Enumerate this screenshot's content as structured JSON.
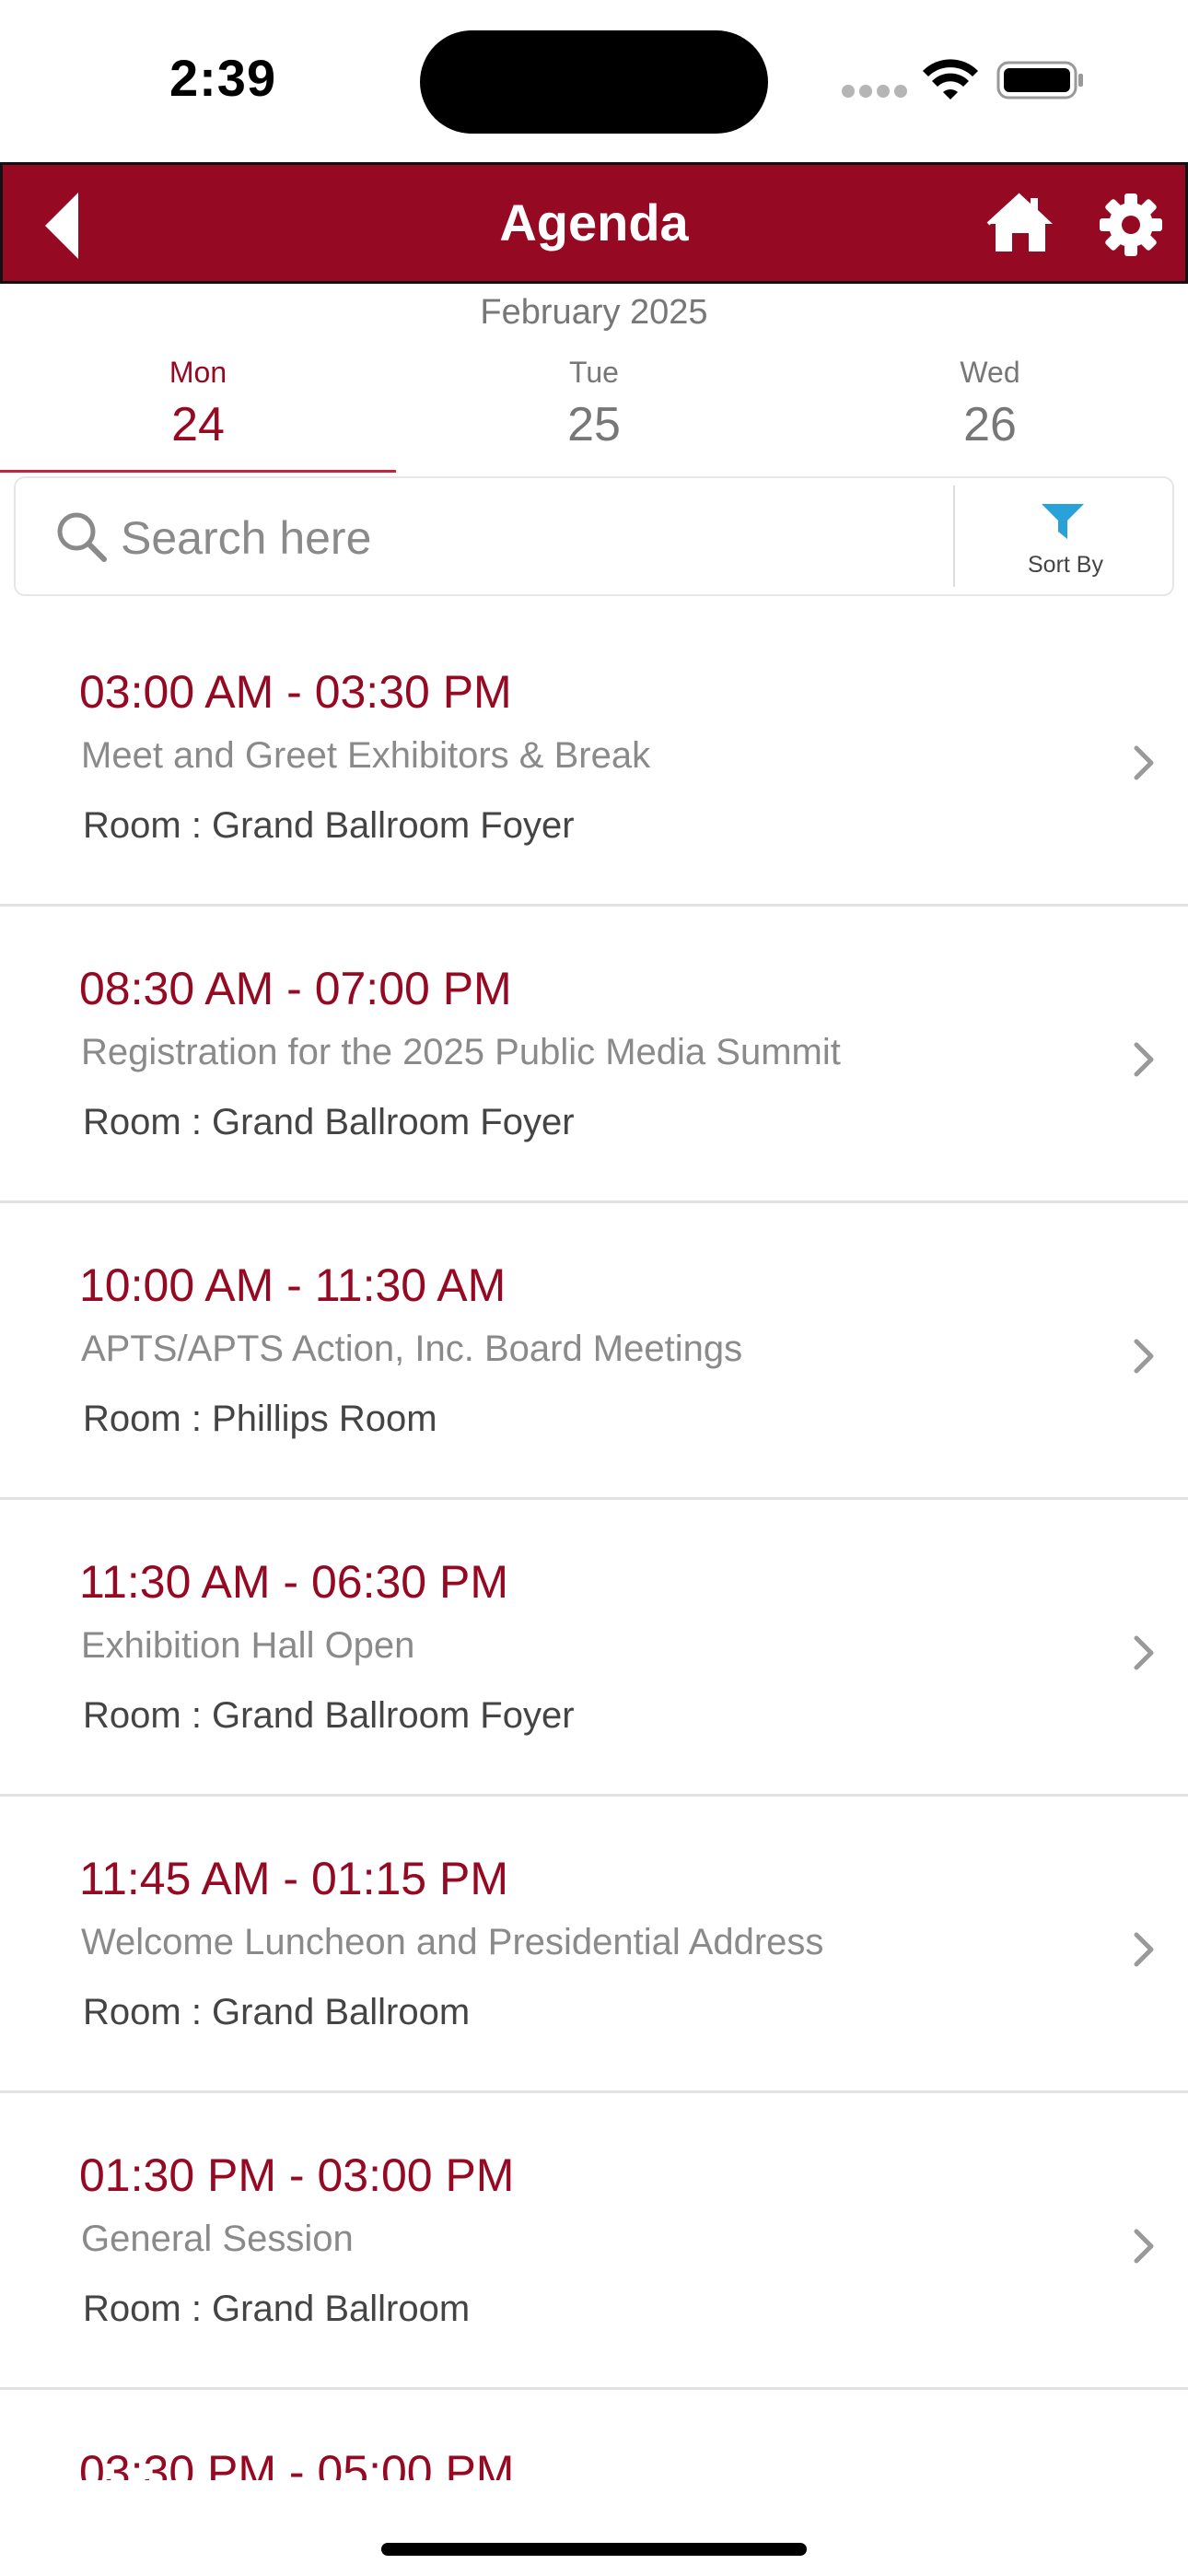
{
  "status_bar": {
    "time": "2:39"
  },
  "header": {
    "title": "Agenda"
  },
  "calendar": {
    "month": "February 2025",
    "days": [
      {
        "name": "Mon",
        "number": "24",
        "active": true
      },
      {
        "name": "Tue",
        "number": "25",
        "active": false
      },
      {
        "name": "Wed",
        "number": "26",
        "active": false
      }
    ]
  },
  "search": {
    "placeholder": "Search here",
    "sort_label": "Sort By"
  },
  "colors": {
    "brand": "#950a22",
    "filter_icon": "#2aa1d8"
  },
  "agenda": [
    {
      "time": "03:00 AM - 03:30 PM",
      "title": "Meet and Greet Exhibitors & Break",
      "room": "Room : Grand Ballroom Foyer"
    },
    {
      "time": "08:30 AM - 07:00 PM",
      "title": "Registration for the 2025 Public Media Summit",
      "room": "Room : Grand Ballroom Foyer"
    },
    {
      "time": "10:00 AM - 11:30 AM",
      "title": "APTS/APTS Action, Inc. Board Meetings",
      "room": "Room : Phillips Room"
    },
    {
      "time": "11:30 AM - 06:30 PM",
      "title": "Exhibition Hall Open",
      "room": "Room : Grand Ballroom Foyer"
    },
    {
      "time": "11:45 AM - 01:15 PM",
      "title": "Welcome Luncheon and Presidential Address",
      "room": "Room : Grand Ballroom"
    },
    {
      "time": "01:30 PM - 03:00 PM",
      "title": "General Session",
      "room": "Room : Grand Ballroom"
    },
    {
      "time": "03:30 PM - 05:00 PM",
      "title": "",
      "room": ""
    }
  ]
}
